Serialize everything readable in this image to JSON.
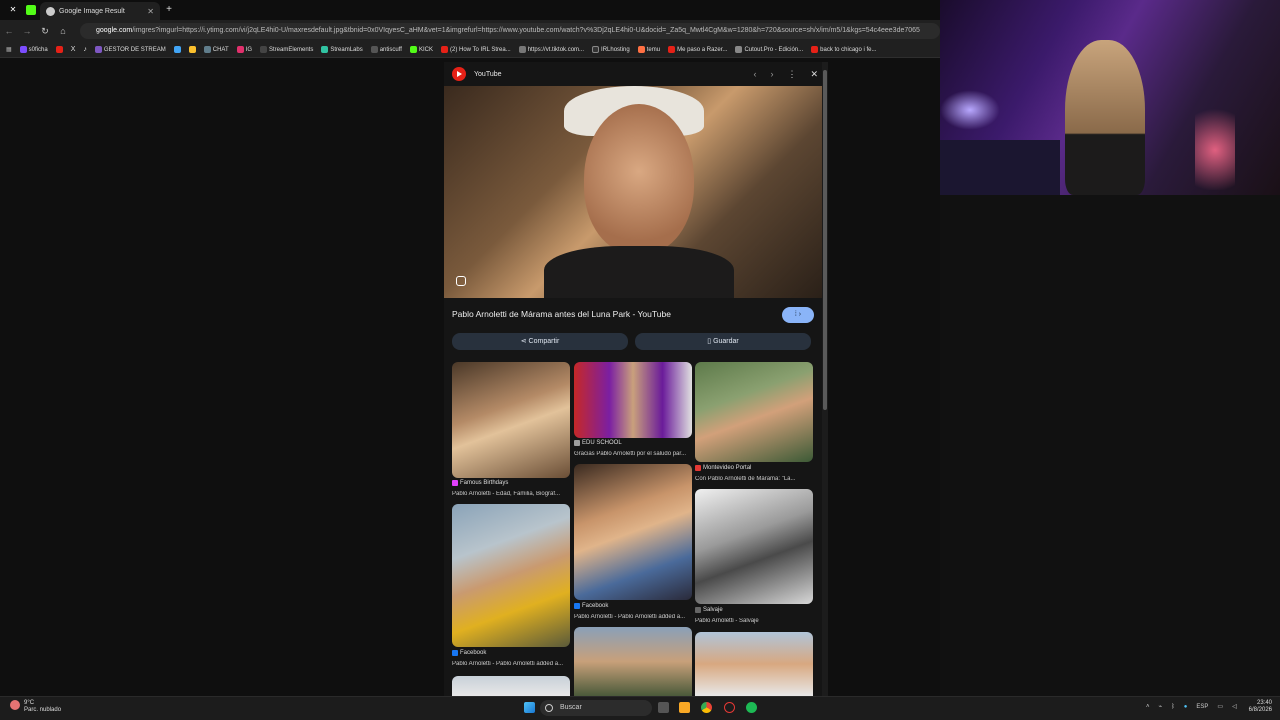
{
  "browser": {
    "active_tab_title": "Google Image Result",
    "url_host": "google.com",
    "url_rest": "/imgres?imgurl=https://i.ytimg.com/vi/j2qLE4hi0-U/maxresdefault.jpg&tbnid=0x0VIqyesC_aHM&vet=1&imgrefurl=https://www.youtube.com/watch?v%3Dj2qLE4hi0-U&docid=_Za5q_Mwtl4CgM&w=1280&h=720&source=sh/x/im/m5/1&kgs=54c4eee3de7065",
    "bookmarks": [
      "s0ficha",
      "GESTOR DE STREAM",
      "CHAT",
      "IG",
      "StreamElements",
      "StreamLabs",
      "antiscuff",
      "KICK",
      "(2) How To IRL Strea...",
      "https://vt.tiktok.com...",
      "IRLhosting",
      "temu",
      "Me paso a Razer...",
      "Cutout.Pro - Edición...",
      "back to chicago i fe..."
    ]
  },
  "panel": {
    "source": "YouTube",
    "title": "Pablo Arnoletti de Márama antes del Luna Park - YouTube",
    "share_label": "Compartir",
    "save_label": "Guardar"
  },
  "related": [
    {
      "source": "Famous Birthdays",
      "title": "Pablo Arnoletti - Edad, Familia, Biograf..."
    },
    {
      "source": "EDU SCHOOL",
      "title": "Gracias Pablo Arnoletti por el saludo par..."
    },
    {
      "source": "Montevideo Portal",
      "title": "Con Pablo Arnoletti de Márama: \"La..."
    },
    {
      "source": "Facebook",
      "title": "Pablo Arnoletti - Pablo Arnoletti added a..."
    },
    {
      "source": "Facebook",
      "title": "Pablo Arnoletti - Pablo Arnoletti added a..."
    },
    {
      "source": "Salvaje",
      "title": "Pablo Arnoletti - Salvaje"
    }
  ],
  "taskbar": {
    "temperature": "9°C",
    "weather": "Parc. nublado",
    "search_label": "Buscar",
    "language": "ESP",
    "time": "23:40",
    "date": "6/8/2026"
  }
}
